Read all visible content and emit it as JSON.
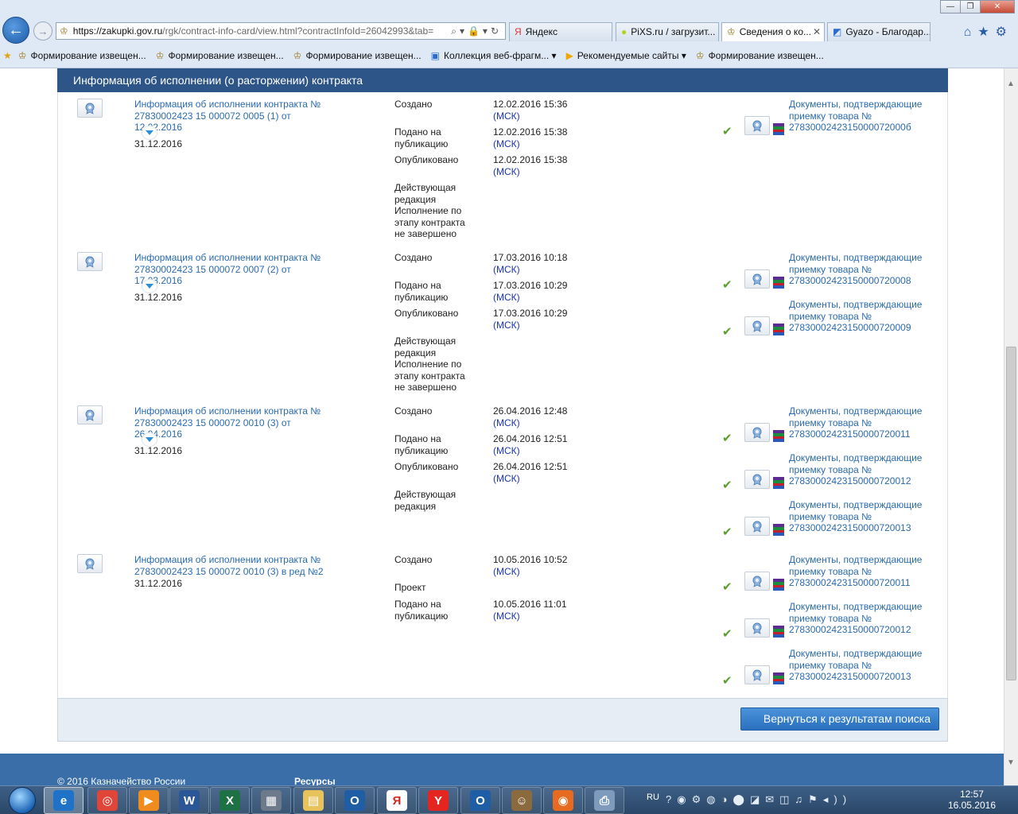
{
  "browser": {
    "url_domain": "https://zakupki.gov.ru",
    "url_rest": "/rgk/contract-info-card/view.html?contractInfoId=26042993&tab=",
    "tabs": [
      {
        "label": "Яндекс",
        "icon": "yandex-icon"
      },
      {
        "label": "PiXS.ru / загрузит...",
        "icon": "pixs-icon"
      },
      {
        "label": "Сведения о ко...",
        "icon": "emblem-icon"
      },
      {
        "label": "Gyazo - Благодар...",
        "icon": "gyazo-icon"
      }
    ],
    "favorites": [
      "Формирование извещен...",
      "Формирование извещен...",
      "Формирование извещен...",
      "Коллекция веб-фрагм...",
      "Рекомендуемые сайты",
      "Формирование извещен..."
    ]
  },
  "section": {
    "title": "Информация об исполнении (о расторжении) контракта"
  },
  "records": [
    {
      "title": "Информация об исполнении контракта № 27830002423 15 000072 0005 (1) от 12.02.2016",
      "date": "31.12.2016",
      "statuses": [
        {
          "label": "Создано",
          "value": "12.02.2016 15:36",
          "tz": "(МСК)"
        },
        {
          "label": "Подано на публикацию",
          "value": "12.02.2016 15:38",
          "tz": "(МСК)"
        },
        {
          "label": "Опубликовано",
          "value": "12.02.2016 15:38",
          "tz": "(МСК)"
        },
        {
          "label": "Действующая редакция",
          "value": "",
          "tz": ""
        },
        {
          "label": "Исполнение по этапу контракта не завершено",
          "value": "",
          "tz": ""
        }
      ],
      "documents": [
        {
          "label": "Документы, подтверждающие приемку товара № 2783000242315000072000б"
        }
      ]
    },
    {
      "title": "Информация об исполнении контракта № 27830002423 15 000072 0007 (2) от 17.03.2016",
      "date": "31.12.2016",
      "statuses": [
        {
          "label": "Создано",
          "value": "17.03.2016 10:18",
          "tz": "(МСК)"
        },
        {
          "label": "Подано на публикацию",
          "value": "17.03.2016 10:29",
          "tz": "(МСК)"
        },
        {
          "label": "Опубликовано",
          "value": "17.03.2016 10:29",
          "tz": "(МСК)"
        },
        {
          "label": "Действующая редакция",
          "value": "",
          "tz": ""
        },
        {
          "label": "Исполнение по этапу контракта не завершено",
          "value": "",
          "tz": ""
        }
      ],
      "documents": [
        {
          "label": "Документы, подтверждающие приемку товара № 27830002423150000720008"
        },
        {
          "label": "Документы, подтверждающие приемку товара № 27830002423150000720009"
        }
      ]
    },
    {
      "title": "Информация об исполнении контракта № 27830002423 15 000072 0010 (3) от 26.04.2016",
      "date": "31.12.2016",
      "statuses": [
        {
          "label": "Создано",
          "value": "26.04.2016 12:48",
          "tz": "(МСК)"
        },
        {
          "label": "Подано на публикацию",
          "value": "26.04.2016 12:51",
          "tz": "(МСК)"
        },
        {
          "label": "Опубликовано",
          "value": "26.04.2016 12:51",
          "tz": "(МСК)"
        },
        {
          "label": "Действующая редакция",
          "value": "",
          "tz": ""
        }
      ],
      "documents": [
        {
          "label": "Документы, подтверждающие приемку товара № 27830002423150000720011"
        },
        {
          "label": "Документы, подтверждающие приемку товара № 27830002423150000720012"
        },
        {
          "label": "Документы, подтверждающие приемку товара № 27830002423150000720013"
        }
      ]
    },
    {
      "title": "Информация об исполнении контракта № 27830002423 15 000072 0010 (3) в ред №2",
      "date": "31.12.2016",
      "statuses": [
        {
          "label": "Создано",
          "value": "10.05.2016 10:52",
          "tz": "(МСК)"
        },
        {
          "label": "Проект",
          "value": "",
          "tz": ""
        },
        {
          "label": "Подано на публикацию",
          "value": "10.05.2016 11:01",
          "tz": "(МСК)"
        }
      ],
      "documents": [
        {
          "label": "Документы, подтверждающие приемку товара № 27830002423150000720011"
        },
        {
          "label": "Документы, подтверждающие приемку товара № 27830002423150000720012"
        },
        {
          "label": "Документы, подтверждающие приемку товара № 27830002423150000720013"
        }
      ]
    }
  ],
  "footer": {
    "back_button": "Вернуться к результатам поиска",
    "copyright": "© 2016 Казначейство России",
    "resources": "Ресурсы"
  },
  "taskbar": {
    "lang": "RU",
    "time": "12:57",
    "date": "16.05.2016",
    "apps": [
      {
        "name": "ie",
        "color": "#1e73c8",
        "glyph": "e"
      },
      {
        "name": "chrome",
        "color": "#e0453a",
        "glyph": "◎"
      },
      {
        "name": "media",
        "color": "#f08c1e",
        "glyph": "▶"
      },
      {
        "name": "word",
        "color": "#2b5797",
        "glyph": "W"
      },
      {
        "name": "excel",
        "color": "#1e7145",
        "glyph": "X"
      },
      {
        "name": "calculator",
        "color": "#6c7a8c",
        "glyph": "▦"
      },
      {
        "name": "explorer",
        "color": "#e8c25a",
        "glyph": "▤"
      },
      {
        "name": "outlook",
        "color": "#1f5ea5",
        "glyph": "O"
      },
      {
        "name": "yandex-browser",
        "color": "#ffffff",
        "glyph": "Я"
      },
      {
        "name": "yandex",
        "color": "#e52620",
        "glyph": "Y"
      },
      {
        "name": "outlook-2",
        "color": "#1f5ea5",
        "glyph": "O"
      },
      {
        "name": "user-app",
        "color": "#8b6a3e",
        "glyph": "☺"
      },
      {
        "name": "firefox",
        "color": "#e66a1f",
        "glyph": "◉"
      },
      {
        "name": "scanner",
        "color": "#7e9bbd",
        "glyph": "⎙"
      }
    ]
  },
  "colors": {
    "header_blue": "#2e5588",
    "link_blue": "#2a6bb0",
    "timezone_blue": "#1a33c0",
    "check_green": "#5aa02c"
  }
}
